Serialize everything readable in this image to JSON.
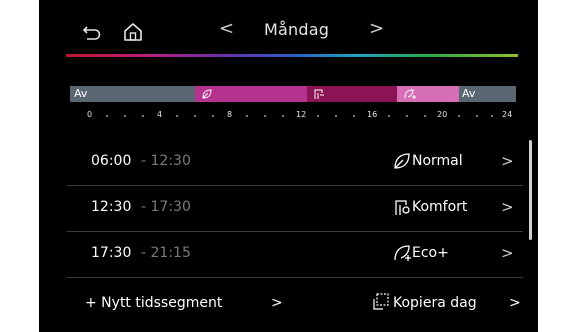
{
  "header": {
    "title": "Måndag",
    "prev_chevron": "<",
    "next_chevron": ">",
    "back_icon": "back-arrow-icon",
    "home_icon": "home-icon"
  },
  "timeline": {
    "segments": [
      {
        "label": "Av",
        "mode": "off",
        "color": "#5a6672"
      },
      {
        "label": "",
        "mode": "normal",
        "color": "#b5328f"
      },
      {
        "label": "",
        "mode": "komfort",
        "color": "#8b1454"
      },
      {
        "label": "",
        "mode": "eco-plus",
        "color": "#d66fb6"
      },
      {
        "label": "Av",
        "mode": "off",
        "color": "#5a6672"
      }
    ],
    "tick_labels": [
      "0",
      "4",
      "8",
      "12",
      "16",
      "20",
      "24"
    ]
  },
  "schedule": [
    {
      "start": "06:00",
      "separator": " - ",
      "end": "12:30",
      "mode": "Normal",
      "icon": "leaf-icon"
    },
    {
      "start": "12:30",
      "separator": " - ",
      "end": "17:30",
      "mode": "Komfort",
      "icon": "shower-icon"
    },
    {
      "start": "17:30",
      "separator": " - ",
      "end": "21:15",
      "mode": "Eco+",
      "icon": "eco-plus-icon"
    }
  ],
  "footer": {
    "add_segment": "+  Nytt tidssegment",
    "add_chevron": ">",
    "copy_day": "Kopiera dag",
    "copy_chevron": ">"
  },
  "colors": {
    "background": "#000000",
    "text_primary": "#ffffff",
    "text_secondary": "#7a7a7a",
    "divider": "#3a3a3a"
  }
}
